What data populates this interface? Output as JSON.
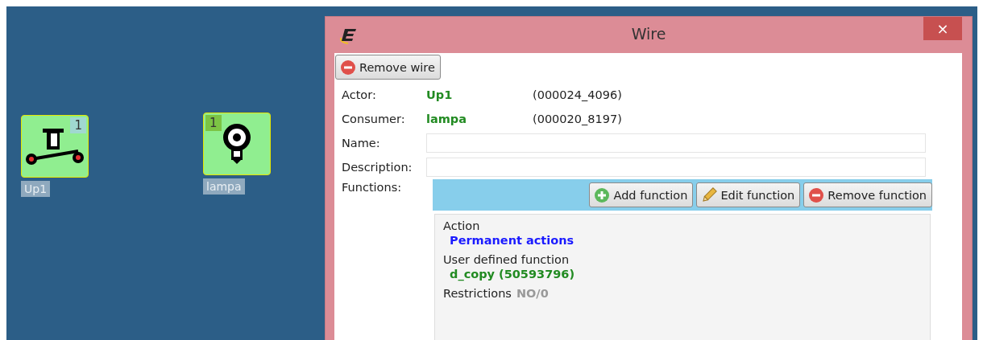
{
  "canvas": {
    "nodes": [
      {
        "kind": "switch",
        "label": "Up1",
        "badge": "1"
      },
      {
        "kind": "lamp",
        "label": "lampa",
        "badge": "1"
      }
    ]
  },
  "dialog": {
    "title": "Wire",
    "close": "×",
    "remove_button": "Remove wire",
    "links": [
      {
        "label": "Actor:",
        "value": "Up1",
        "id": "(000024_4096)"
      },
      {
        "label": "Consumer:",
        "value": "lampa",
        "id": "(000020_8197)"
      }
    ],
    "fields": [
      {
        "label": "Name:"
      },
      {
        "label": "Description:"
      }
    ],
    "functions": {
      "label": "Functions:",
      "buttons": [
        {
          "kind": "add",
          "label": "Add function"
        },
        {
          "kind": "edit",
          "label": "Edit function"
        },
        {
          "kind": "remove",
          "label": "Remove function"
        }
      ],
      "details": [
        {
          "kind": "stacked",
          "label": "Action",
          "value": "Permanent actions",
          "color": "#1a1aff"
        },
        {
          "kind": "stacked",
          "label": "User defined function",
          "value": "d_copy (50593796)",
          "color": "#228b22"
        },
        {
          "kind": "inline",
          "label": "Restrictions",
          "value": "NO/0",
          "color": "#999999"
        }
      ]
    }
  }
}
